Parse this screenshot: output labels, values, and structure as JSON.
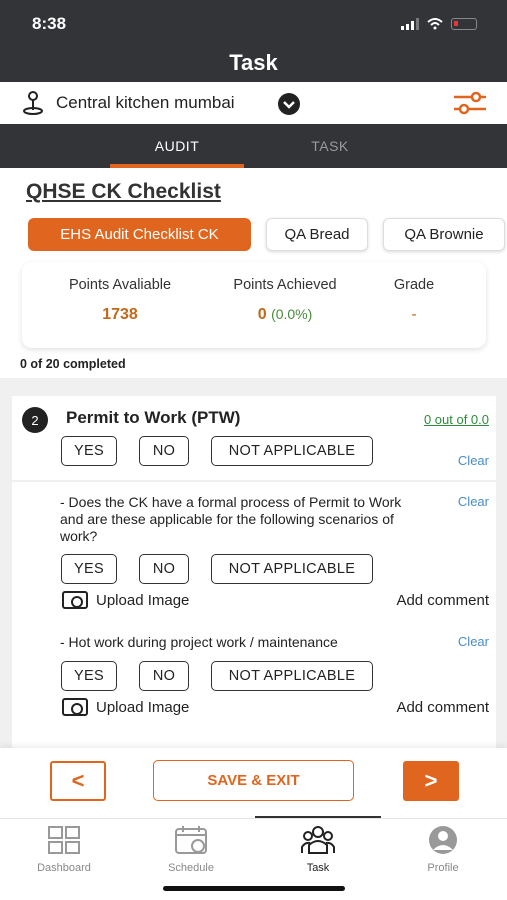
{
  "status": {
    "time": "8:38"
  },
  "header": {
    "title": "Task"
  },
  "location": {
    "name": "Central kitchen mumbai"
  },
  "tabs": {
    "audit": "AUDIT",
    "task": "TASK"
  },
  "checklist": {
    "title": "QHSE CK Checklist",
    "chips": [
      "EHS Audit Checklist CK",
      "QA Bread",
      "QA Brownie"
    ]
  },
  "stats": {
    "points_available_label": "Points Avaliable",
    "points_available_value": "1738",
    "points_achieved_label": "Points Achieved",
    "points_achieved_value": "0",
    "points_achieved_pct": "(0.0%)",
    "grade_label": "Grade",
    "grade_value": "-"
  },
  "progress": {
    "text": "0 of 20 completed"
  },
  "section": {
    "number": "2",
    "title": "Permit to Work (PTW)",
    "score": "0 out of 0.0",
    "clear": "Clear",
    "options": [
      "YES",
      "NO",
      "NOT APPLICABLE"
    ]
  },
  "questions": [
    {
      "text": "- Does the CK have a formal process of Permit to Work and are these applicable for the following scenarios of work?",
      "clear": "Clear",
      "upload": "Upload Image",
      "comment": "Add comment"
    },
    {
      "text": "- Hot work during project work / maintenance",
      "clear": "Clear",
      "upload": "Upload Image",
      "comment": "Add comment"
    }
  ],
  "actions": {
    "back": "<",
    "save": "SAVE & EXIT",
    "next": ">"
  },
  "tabbar": [
    "Dashboard",
    "Schedule",
    "Task",
    "Profile"
  ],
  "colors": {
    "accent": "#e0661f",
    "header": "#323437",
    "score_green": "#2e8b3a",
    "link_blue": "#4a8ccf"
  }
}
